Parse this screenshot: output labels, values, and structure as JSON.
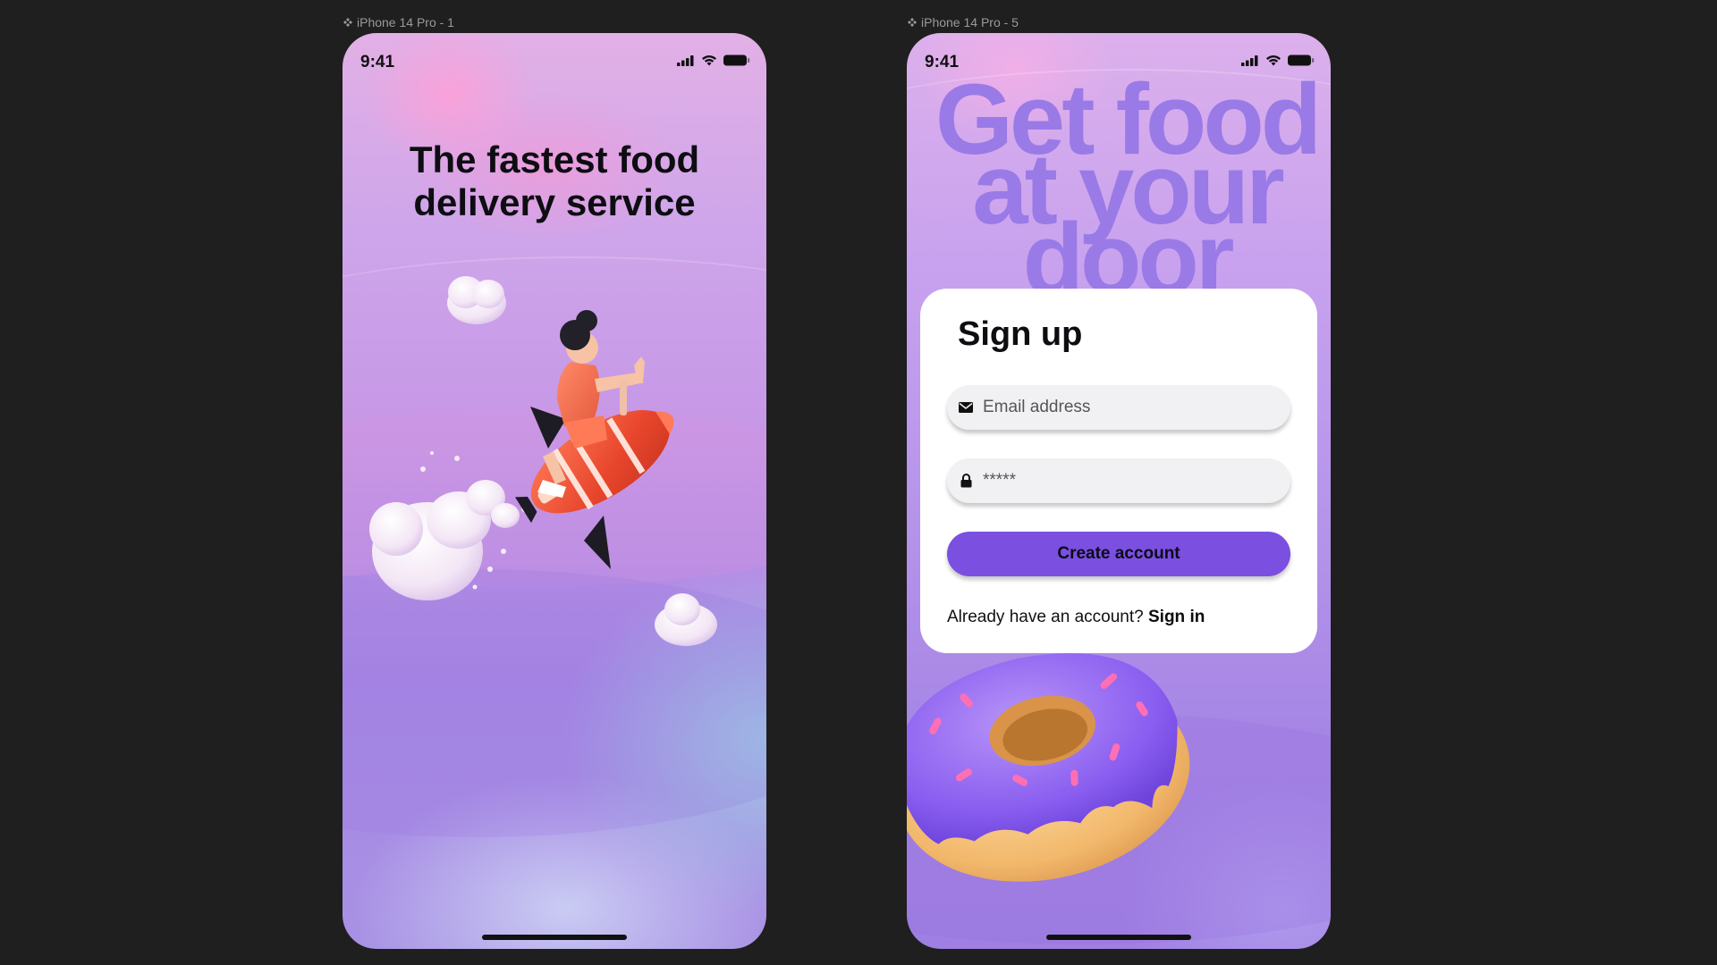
{
  "frames": [
    {
      "label": "iPhone 14 Pro - 1",
      "status_time": "9:41",
      "title_lines": [
        "The fastest food",
        "delivery service"
      ]
    },
    {
      "label": "iPhone 14 Pro - 5",
      "status_time": "9:41",
      "bg_headline_lines": [
        "Get food",
        "at your",
        "door"
      ],
      "signup": {
        "title": "Sign up",
        "email_placeholder": "Email address",
        "password_placeholder": "*****",
        "create_account_label": "Create account",
        "already_text": "Already have an account?",
        "signin_link": "Sign in"
      }
    }
  ],
  "colors": {
    "canvas_bg": "#1f1f1f",
    "accent": "#7b4fe0",
    "headline_purple": "#9a7ae6"
  },
  "icons": [
    "component-icon",
    "signal-icon",
    "wifi-icon",
    "battery-icon",
    "mail-icon",
    "lock-icon"
  ]
}
